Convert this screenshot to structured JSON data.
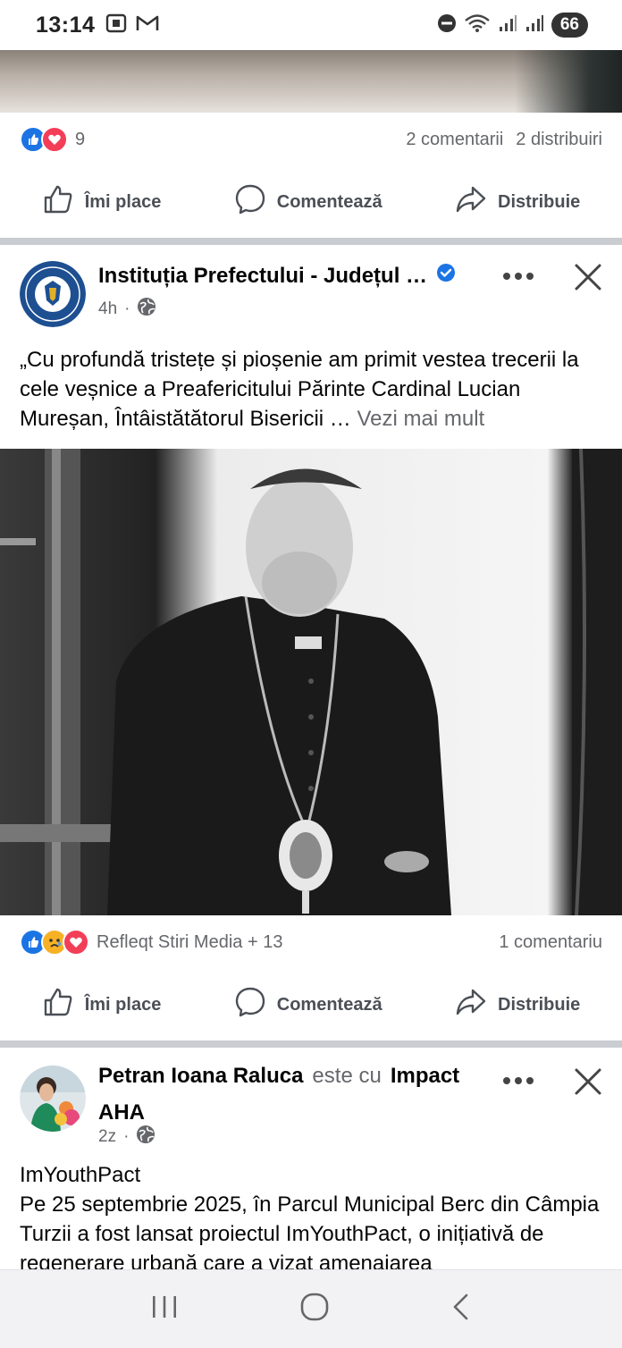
{
  "status_bar": {
    "time": "13:14",
    "battery": "66",
    "left_icons": [
      "screenshot-icon",
      "gmail-icon"
    ],
    "right_icons": [
      "dnd-icon",
      "wifi-icon",
      "signal-icon",
      "signal-icon"
    ]
  },
  "previous_post": {
    "reaction_count": "9",
    "comments": "2 comentarii",
    "shares": "2 distribuiri"
  },
  "actions": {
    "like": "Îmi place",
    "comment": "Comentează",
    "share": "Distribuie"
  },
  "post1": {
    "author": "Instituția Prefectului - Județul …",
    "verified": true,
    "time": "4h",
    "visibility_icon": "globe-icon",
    "text": "„Cu profundă tristețe și pioșenie am primit vestea trecerii la cele veșnice a Preafericitului Părinte Cardinal Lucian Mureșan, Întâistătătorul Bisericii … ",
    "see_more": "Vezi mai mult",
    "reactions_label": "Refleqt Stiri Media + 13",
    "comments": "1 comentariu"
  },
  "post2": {
    "author": "Petran Ioana Raluca",
    "with_text": "este cu",
    "tagged": "Impact",
    "tagged_line2": "AHA",
    "time": "2z",
    "visibility_icon": "globe-icon",
    "text": "ImYouthPact\nPe 25 septembrie 2025, în Parcul Municipal Berc din Câmpia Turzii a fost lansat proiectul ImYouthPact, o inițiativă de regenerare urbană care a vizat amenajarea"
  },
  "colors": {
    "fb_blue": "#1b74e4",
    "love_red": "#f33e58",
    "sad_yellow": "#f7b125",
    "secondary_text": "#65676b",
    "divider": "#c9ccd1"
  }
}
